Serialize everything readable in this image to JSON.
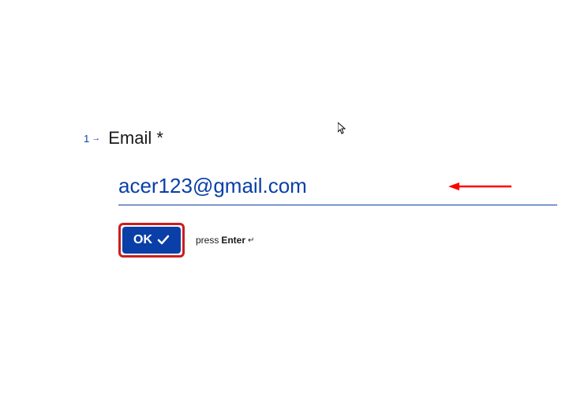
{
  "form": {
    "question_number": "1",
    "question_label": "Email *",
    "email_value": "acer123@gmail.com"
  },
  "button": {
    "ok_label": "OK"
  },
  "hint": {
    "press": "press",
    "enter": "Enter",
    "symbol": "↵"
  },
  "colors": {
    "accent": "#0a3fa8",
    "highlight_border": "#c91e1e",
    "arrow": "#ff0000"
  }
}
